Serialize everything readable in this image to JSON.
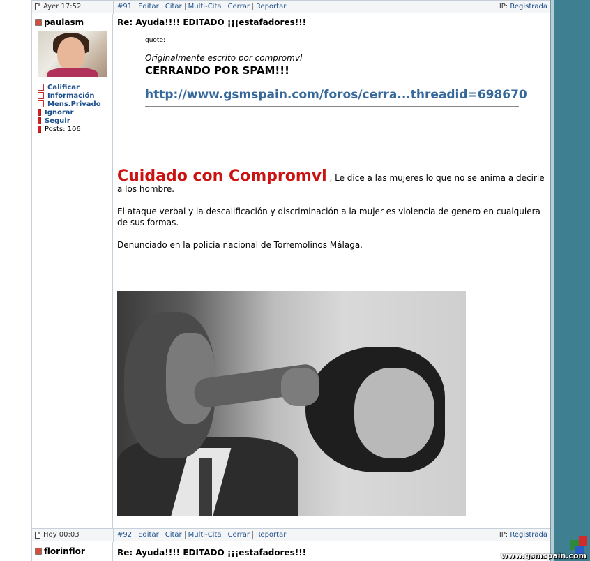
{
  "posts": [
    {
      "date": "Ayer 17:52",
      "number": "#91",
      "actions": [
        "Editar",
        "Citar",
        "Multi-Cita",
        "Cerrar",
        "Reportar"
      ],
      "ip_label": "IP:",
      "ip_value": "Registrada",
      "username": "paulasm",
      "user_links": [
        "Calificar",
        "Información",
        "Mens.Privado",
        "Ignorar",
        "Seguir"
      ],
      "posts_count": "Posts: 106",
      "title": "Re: Ayuda!!!! EDITADO ¡¡¡estafadores!!!",
      "quote": {
        "label": "quote:",
        "author_prefix": "Originalmente escrito por",
        "author": "compromvl",
        "headline": "CERRANDO POR SPAM!!!",
        "link": "http://www.gsmspain.com/foros/cerra...threadid=698670"
      },
      "body": {
        "red_heading": "Cuidado con Compromvl",
        "line1": " , Le dice a las mujeres lo que no se anima a decirle a los hombre.",
        "para2": "El ataque verbal y la descalificación y discriminación a la mujer es violencia de genero en cualquiera de sus formas.",
        "para3": "Denunciado en la policía nacional de Torremolinos Málaga."
      }
    },
    {
      "date": "Hoy 00:03",
      "number": "#92",
      "actions": [
        "Editar",
        "Citar",
        "Multi-Cita",
        "Cerrar",
        "Reportar"
      ],
      "ip_label": "IP:",
      "ip_value": "Registrada",
      "username": "florinflor",
      "title": "Re: Ayuda!!!! EDITADO ¡¡¡estafadores!!!"
    }
  ],
  "logo": {
    "text": "www.gsmspain.com"
  }
}
